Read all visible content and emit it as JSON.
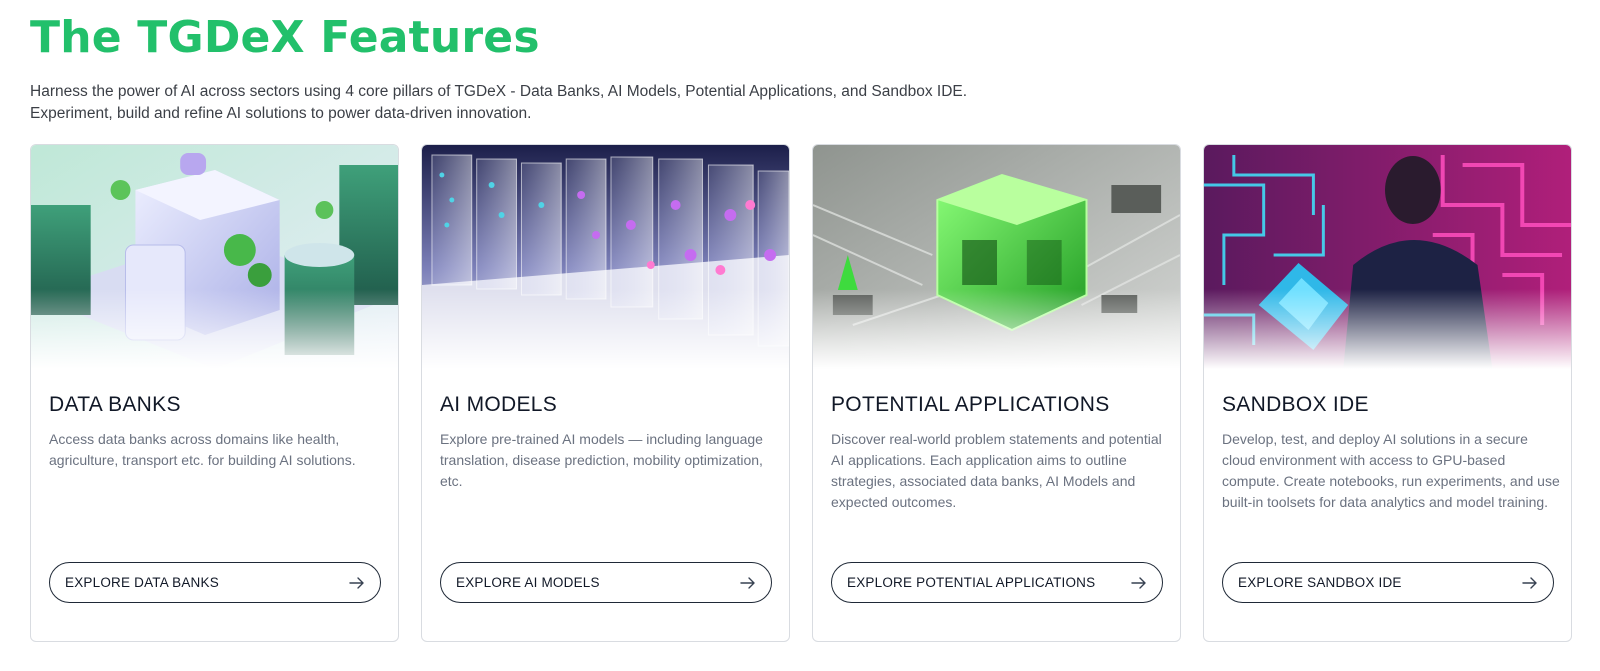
{
  "header": {
    "title": "The TGDeX Features",
    "intro_line1": "Harness the power of AI across sectors using 4 core pillars of TGDeX - Data Banks, AI Models, Potential Applications, and Sandbox IDE.",
    "intro_line2": "Experiment, build and refine AI solutions to power data-driven innovation."
  },
  "cards": [
    {
      "title": "DATA BANKS",
      "description": "Access data banks across domains like health, agriculture, transport etc. for building AI solutions.",
      "button_label": "EXPLORE DATA BANKS",
      "image_icon": "isometric-data-center-image"
    },
    {
      "title": "AI MODELS",
      "description": "Explore pre-trained AI models — including language translation, disease prediction, mobility optimization, etc.",
      "button_label": "EXPLORE AI MODELS",
      "image_icon": "glass-panels-image"
    },
    {
      "title": "POTENTIAL APPLICATIONS",
      "description": "Discover real-world problem statements and potential AI applications. Each application aims to outline strategies, associated data banks, AI Models and expected outcomes.",
      "button_label": "EXPLORE POTENTIAL APPLICATIONS",
      "image_icon": "green-chip-image"
    },
    {
      "title": "SANDBOX IDE",
      "description": "Develop, test, and deploy AI solutions in a secure cloud environment with access to GPU-based compute. Create notebooks, run experiments, and use built-in toolsets for data analytics and model training.",
      "button_label": "EXPLORE SANDBOX IDE",
      "image_icon": "developer-neon-image"
    }
  ],
  "colors": {
    "accent": "#22c06b",
    "text_dark": "#111827",
    "text_muted": "#6b7280",
    "card_border": "#d9dce1"
  }
}
